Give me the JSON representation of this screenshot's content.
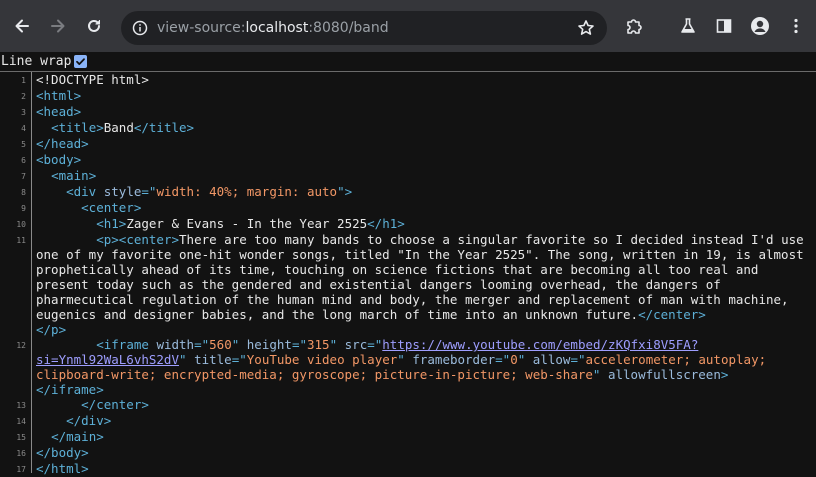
{
  "browser": {
    "url_scheme": "view-source:",
    "url_host": "localhost",
    "url_rest": ":8080/band"
  },
  "wrapbar": {
    "label": "Line wrap",
    "checked": true
  },
  "source": {
    "line_numbers": [
      "1",
      "2",
      "3",
      "4",
      "5",
      "6",
      "7",
      "8",
      "9",
      "10",
      "11",
      "12",
      "13",
      "14",
      "15",
      "16",
      "17"
    ],
    "l1": "<!DOCTYPE html>",
    "l2": "<html>",
    "l3": "<head>",
    "l4_open": "<title>",
    "l4_text": "Band",
    "l4_close": "</title>",
    "l5": "</head>",
    "l6": "<body>",
    "l7": "<main>",
    "l8_open": "<div ",
    "l8_attr": "style",
    "l8_eq": "=\"",
    "l8_val": "width: 40%; margin: auto",
    "l8_end": "\">",
    "l9": "<center>",
    "l10_open": "<h1>",
    "l10_text": "Zager & Evans - In the Year 2525",
    "l10_close": "</h1>",
    "l11_open": "<p><center>",
    "l11_text": "There are too many bands to choose a singular favorite so I decided instead I'd use one of my favorite one-hit wonder songs, titled \"In the Year 2525\". The song, written in 19, is almost prophetically ahead of its time, touching on science fictions that are becoming all too real and present today such as the gendered and existential dangers looming overhead, the dangers of pharmecutical regulation of the human mind and body, the merger and replacement of man with machine, eugenics and designer babies, and the long march of time into an unknown future.",
    "l11_close1": "</center>",
    "l11_close2": "</p>",
    "l12_open": "<iframe ",
    "l12_a1": "width",
    "l12_v1": "560",
    "l12_a2": "height",
    "l12_v2": "315",
    "l12_a3": "src",
    "l12_v3": "https://www.youtube.com/embed/zKQfxi8V5FA?si=Ynml92WaL6vhS2dV",
    "l12_a4": "title",
    "l12_v4": "YouTube video player",
    "l12_a5": "frameborder",
    "l12_v5": "0",
    "l12_a6": "allow",
    "l12_v6": "accelerometer; autoplay; clipboard-write; encrypted-media; gyroscope; picture-in-picture; web-share",
    "l12_a7": "allowfullscreen",
    "l12_close": "</iframe>",
    "l13": "</center>",
    "l14": "</div>",
    "l15": "</main>",
    "l16": "</body>",
    "l17": "</html>"
  }
}
